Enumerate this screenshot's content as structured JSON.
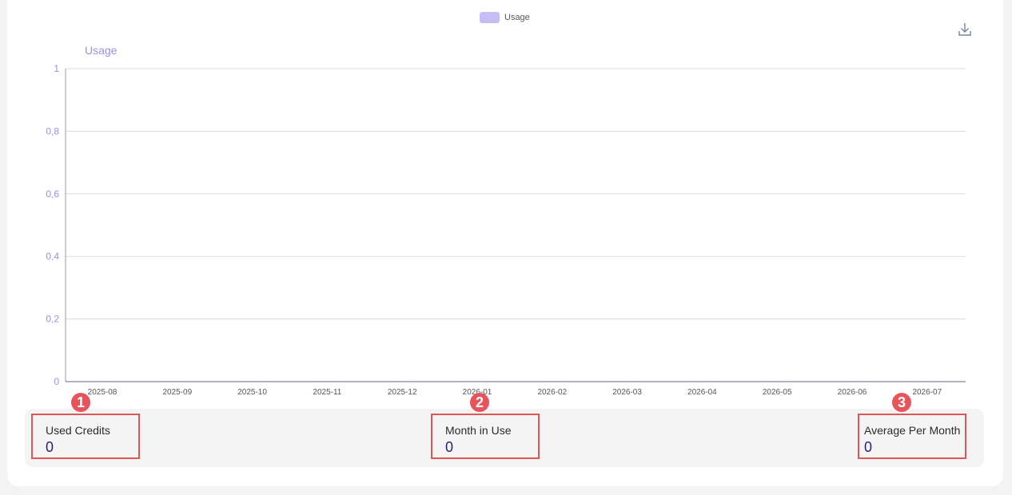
{
  "chart_data": {
    "type": "bar",
    "title": "",
    "xlabel": "",
    "ylabel": "Usage",
    "ylim": [
      0,
      1
    ],
    "yticks": [
      {
        "value": 0,
        "label": "0"
      },
      {
        "value": 0.2,
        "label": "0,2"
      },
      {
        "value": 0.4,
        "label": "0,4"
      },
      {
        "value": 0.6,
        "label": "0,6"
      },
      {
        "value": 0.8,
        "label": "0,8"
      },
      {
        "value": 1,
        "label": "1"
      }
    ],
    "categories": [
      "2025-08",
      "2025-09",
      "2025-10",
      "2025-11",
      "2025-12",
      "2026-01",
      "2026-02",
      "2026-03",
      "2026-04",
      "2026-05",
      "2026-06",
      "2026-07"
    ],
    "series": [
      {
        "name": "Usage",
        "values": [
          0,
          0,
          0,
          0,
          0,
          0,
          0,
          0,
          0,
          0,
          0,
          0
        ]
      }
    ],
    "grid": true,
    "legend": "top-center"
  },
  "legend": {
    "label": "Usage"
  },
  "colors": {
    "series": "#c4bef5",
    "axis_text": "#9b8fe6",
    "highlight": "#e05555",
    "value": "#2a2470"
  },
  "icons": {
    "download": "download-icon"
  },
  "stats": [
    {
      "marker": "1",
      "label": "Used Credits",
      "value": "0"
    },
    {
      "marker": "2",
      "label": "Month in Use",
      "value": "0"
    },
    {
      "marker": "3",
      "label": "Average Per Month",
      "value": "0"
    }
  ]
}
